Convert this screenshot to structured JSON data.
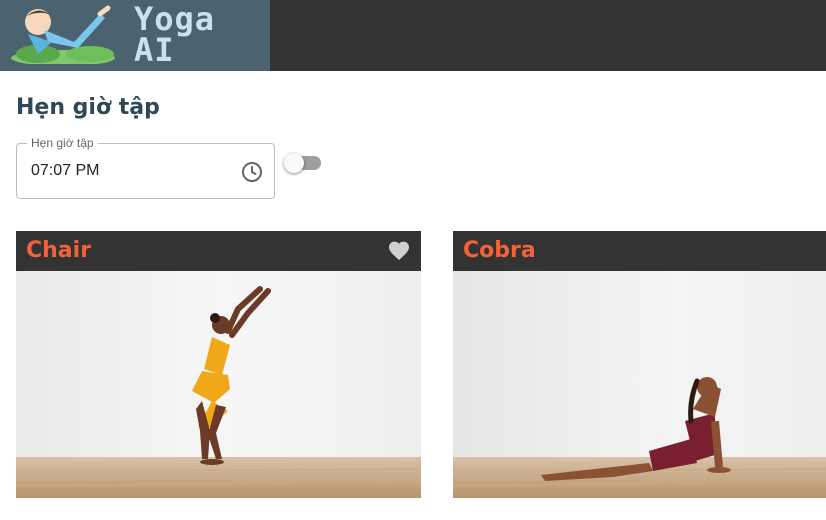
{
  "header": {
    "logo_line1": "Yoga",
    "logo_line2": "AI"
  },
  "reminder": {
    "title": "Hẹn giờ tập",
    "field_label": "Hẹn giờ tập",
    "time_value": "07:07 PM",
    "toggle_on": false
  },
  "poses": [
    {
      "name": "Chair",
      "favorite": false
    },
    {
      "name": "Cobra",
      "favorite": false
    }
  ],
  "colors": {
    "topbar": "#333333",
    "accent": "#f4623a",
    "title": "#2f4858"
  },
  "icons": {
    "time": "clock-icon",
    "favorite": "heart-icon"
  }
}
